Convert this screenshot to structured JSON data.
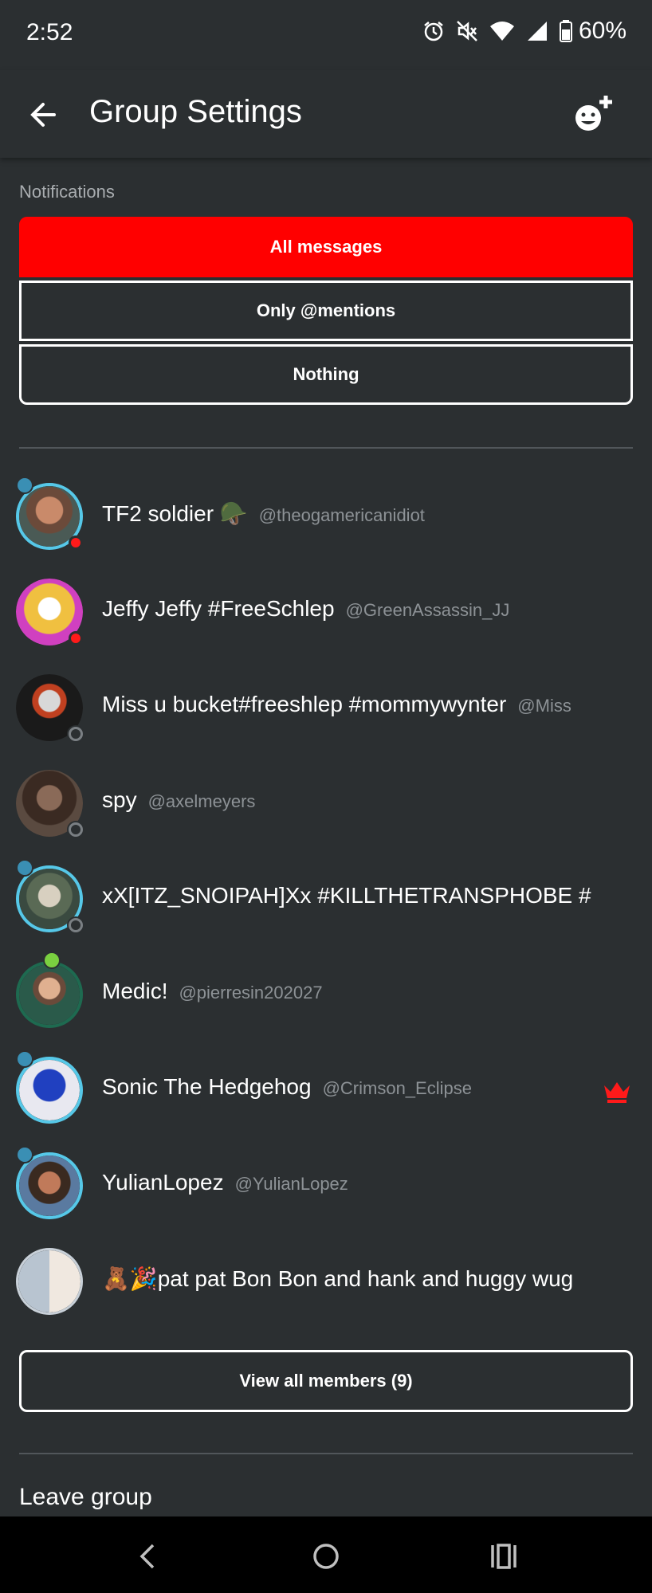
{
  "status_bar": {
    "time": "2:52",
    "battery": "60%",
    "icons": [
      "alarm-icon",
      "mute-icon",
      "wifi-icon",
      "signal-icon",
      "battery-icon"
    ]
  },
  "app_bar": {
    "title": "Group Settings",
    "back_icon": "arrow-left-icon",
    "add_icon": "add-member-icon"
  },
  "notifications": {
    "label": "Notifications",
    "options": [
      "All messages",
      "Only @mentions",
      "Nothing"
    ],
    "selected": "All messages",
    "accent": "#ff0000"
  },
  "members": [
    {
      "name": "TF2 soldier 🪖",
      "handle": "@theogamericanidiot",
      "status": "dnd"
    },
    {
      "name": "Jeffy Jeffy #FreeSchlep",
      "handle": "@GreenAssassin_JJ",
      "status": "dnd"
    },
    {
      "name": "Miss u bucket#freeshlep #mommywynter",
      "handle": "@Miss",
      "status": "offline"
    },
    {
      "name": "spy",
      "handle": "@axelmeyers",
      "status": "offline"
    },
    {
      "name": "xX[ITZ_SNOIPAH]Xx #KILLTHETRANSPHOBE #",
      "handle": "",
      "status": "offline"
    },
    {
      "name": "Medic!",
      "handle": "@pierresin202027",
      "status": "none"
    },
    {
      "name": "Sonic The Hedgehog",
      "handle": "@Crimson_Eclipse",
      "status": "owner"
    },
    {
      "name": "YulianLopez",
      "handle": "@YulianLopez",
      "status": "none"
    },
    {
      "name": "🧸🎉pat pat Bon Bon and hank and huggy wug",
      "handle": "",
      "status": "none"
    }
  ],
  "view_all": "View all members (9)",
  "leave": "Leave group"
}
